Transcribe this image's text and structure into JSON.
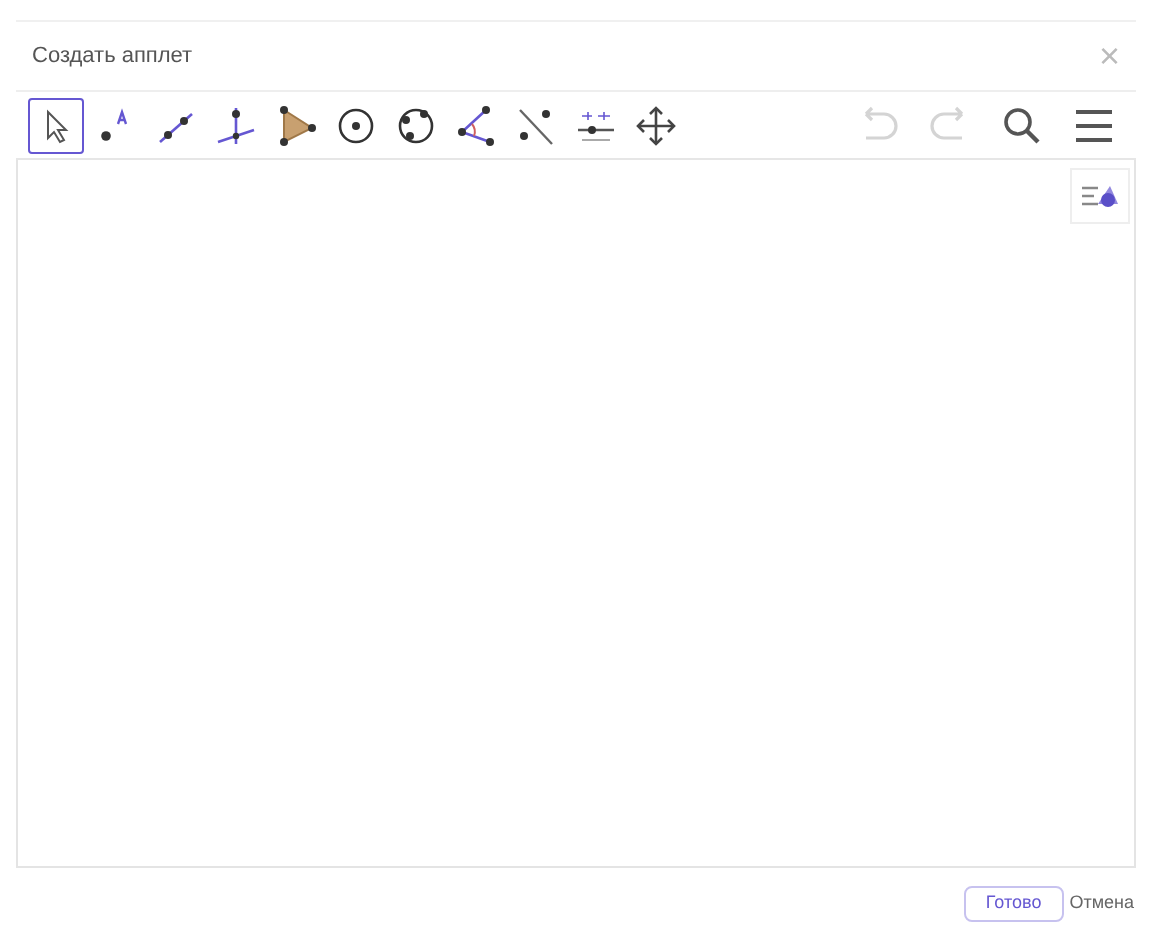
{
  "dialog": {
    "title": "Создать апплет",
    "close_label": "×"
  },
  "tools": [
    {
      "kind": "move",
      "selected": true
    },
    {
      "kind": "point",
      "selected": false
    },
    {
      "kind": "segment",
      "selected": false
    },
    {
      "kind": "perpendicular",
      "selected": false
    },
    {
      "kind": "polygon",
      "selected": false
    },
    {
      "kind": "circle",
      "selected": false
    },
    {
      "kind": "conic",
      "selected": false
    },
    {
      "kind": "angle",
      "selected": false
    },
    {
      "kind": "reflect",
      "selected": false
    },
    {
      "kind": "slider",
      "selected": false
    },
    {
      "kind": "pan",
      "selected": false
    }
  ],
  "actions": [
    {
      "kind": "undo",
      "disabled": true
    },
    {
      "kind": "redo",
      "disabled": true
    },
    {
      "kind": "search",
      "disabled": false
    },
    {
      "kind": "menu",
      "disabled": false
    }
  ],
  "buttons": [
    {
      "label": "Готово",
      "kind": "primary"
    },
    {
      "label": "Отмена",
      "kind": "plain"
    }
  ]
}
